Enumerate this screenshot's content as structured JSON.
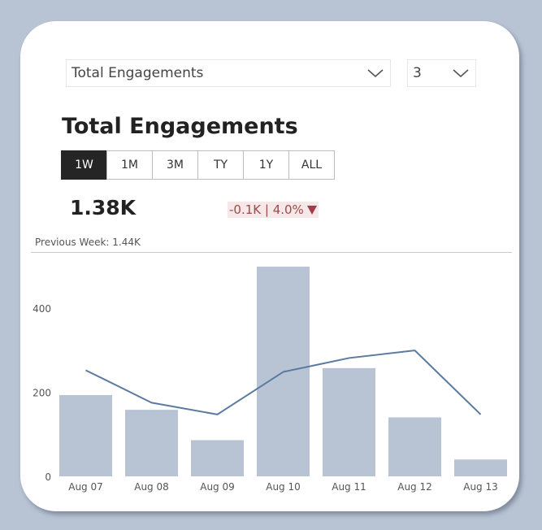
{
  "filters": {
    "metric_value": "Total Engagements",
    "count_value": "3"
  },
  "title": "Total Engagements",
  "range_tabs": [
    {
      "label": "1W",
      "active": true
    },
    {
      "label": "1M",
      "active": false
    },
    {
      "label": "3M",
      "active": false
    },
    {
      "label": "TY",
      "active": false
    },
    {
      "label": "1Y",
      "active": false
    },
    {
      "label": "ALL",
      "active": false
    }
  ],
  "kpi": {
    "value": "1.38K",
    "change": "-0.1K | 4.0%",
    "previous": "Previous Week: 1.44K"
  },
  "colors": {
    "bar": "#b8c4d4",
    "line": "#5b7aa1",
    "active_tab": "#252525",
    "change_bg": "#f6e8e8",
    "change_text": "#9a4b4b",
    "down_arrow": "#a33b48"
  },
  "chart_data": {
    "type": "bar",
    "categories": [
      "Aug 07",
      "Aug 08",
      "Aug 09",
      "Aug 10",
      "Aug 11",
      "Aug 12",
      "Aug 13"
    ],
    "series": [
      {
        "type": "bar",
        "values": [
          193,
          158,
          86,
          498,
          257,
          140,
          40
        ]
      },
      {
        "type": "line",
        "values": [
          252,
          175,
          147,
          248,
          281,
          299,
          147
        ]
      }
    ],
    "y_ticks": [
      0,
      200,
      400
    ],
    "ylim": [
      0,
      500
    ],
    "grid": false
  }
}
